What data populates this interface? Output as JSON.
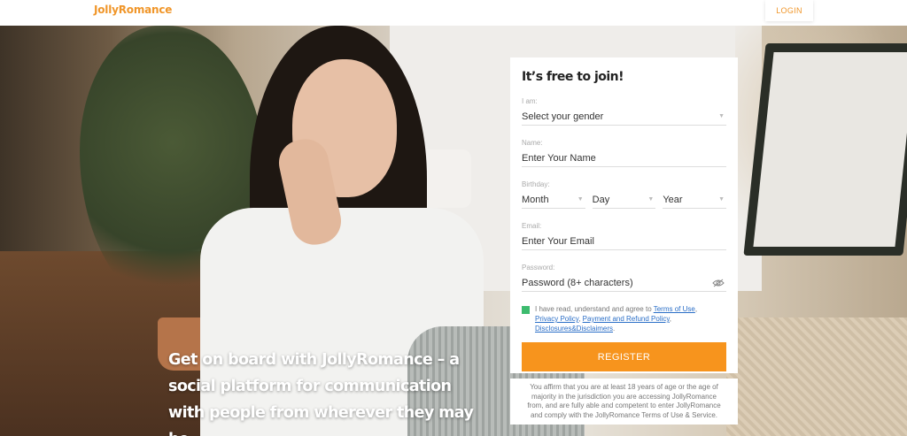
{
  "header": {
    "logo": "JollyRomance",
    "login_label": "LOGIN"
  },
  "hero": {
    "tagline": "Get on board with JollyRomance – a social platform for communication with people from wherever they may be."
  },
  "form": {
    "title": "It’s free to join!",
    "gender": {
      "label": "I am:",
      "value": "Select your gender"
    },
    "name": {
      "label": "Name:",
      "placeholder": "Enter Your Name"
    },
    "birthday": {
      "label": "Birthday:",
      "month": "Month",
      "day": "Day",
      "year": "Year"
    },
    "email": {
      "label": "Email:",
      "placeholder": "Enter Your Email"
    },
    "password": {
      "label": "Password:",
      "placeholder": "Password (8+ characters)"
    },
    "agree": {
      "checked": true,
      "prefix": "I have read, understand and agree to ",
      "terms": "Terms of Use",
      "sep1": ",",
      "privacy": "Privacy Policy",
      "sep2": ", ",
      "payment": "Payment and Refund Policy",
      "sep3": ",",
      "disclosures": "Disclosures&Disclaimers",
      "end": "."
    },
    "register_label": "REGISTER"
  },
  "disclaimer": "You affirm that you are at least 18 years of age or the age of majority in the jurisdiction you are accessing JollyRomance from, and are fully able and competent to enter JollyRomance and comply with the JollyRomance Terms of Use & Service.",
  "colors": {
    "accent": "#f7941d",
    "logo": "#f0962a",
    "checkbox": "#3dbb6e",
    "link": "#2a6ec7"
  }
}
